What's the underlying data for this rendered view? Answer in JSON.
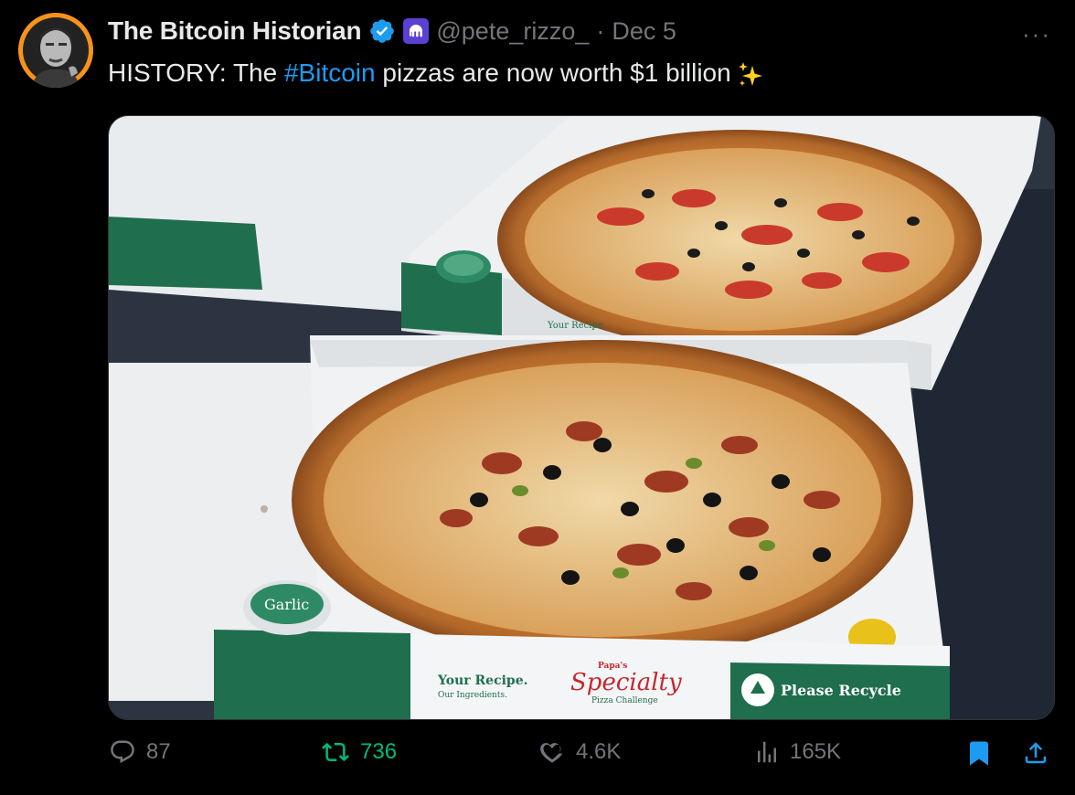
{
  "tweet": {
    "author_name": "The Bitcoin Historian",
    "handle": "@pete_rizzo_",
    "separator": "·",
    "date": "Dec 5",
    "text_prefix": "HISTORY: The ",
    "hashtag": "#Bitcoin",
    "text_suffix": " pizzas are now worth $1 billion",
    "more_label": "···",
    "media_alt": "Two Papa John's pizzas in open boxes"
  },
  "media_text": {
    "box_recipe": "Your Recipe.",
    "box_ingredients": "Our Ingredients.",
    "box_brand_small": "Papa's",
    "box_specialty": "Specialty",
    "box_challenge": "Pizza Challenge",
    "box_recycle": "Please Recycle",
    "cup_label": "Garlic",
    "back_box_recipe": "Your Recipe"
  },
  "actions": {
    "replies": "87",
    "retweets": "736",
    "likes": "4.6K",
    "views": "165K"
  },
  "colors": {
    "background": "#000000",
    "accent": "#1d9bf0",
    "retweet": "#00ba7c",
    "muted": "#71767b",
    "avatar_ring": "#f7931a"
  },
  "icons": [
    "verified-icon",
    "kraken-badge-icon",
    "sparkles-icon",
    "more-icon",
    "reply-icon",
    "retweet-icon",
    "like-icon",
    "views-icon",
    "bookmark-icon",
    "share-icon"
  ]
}
